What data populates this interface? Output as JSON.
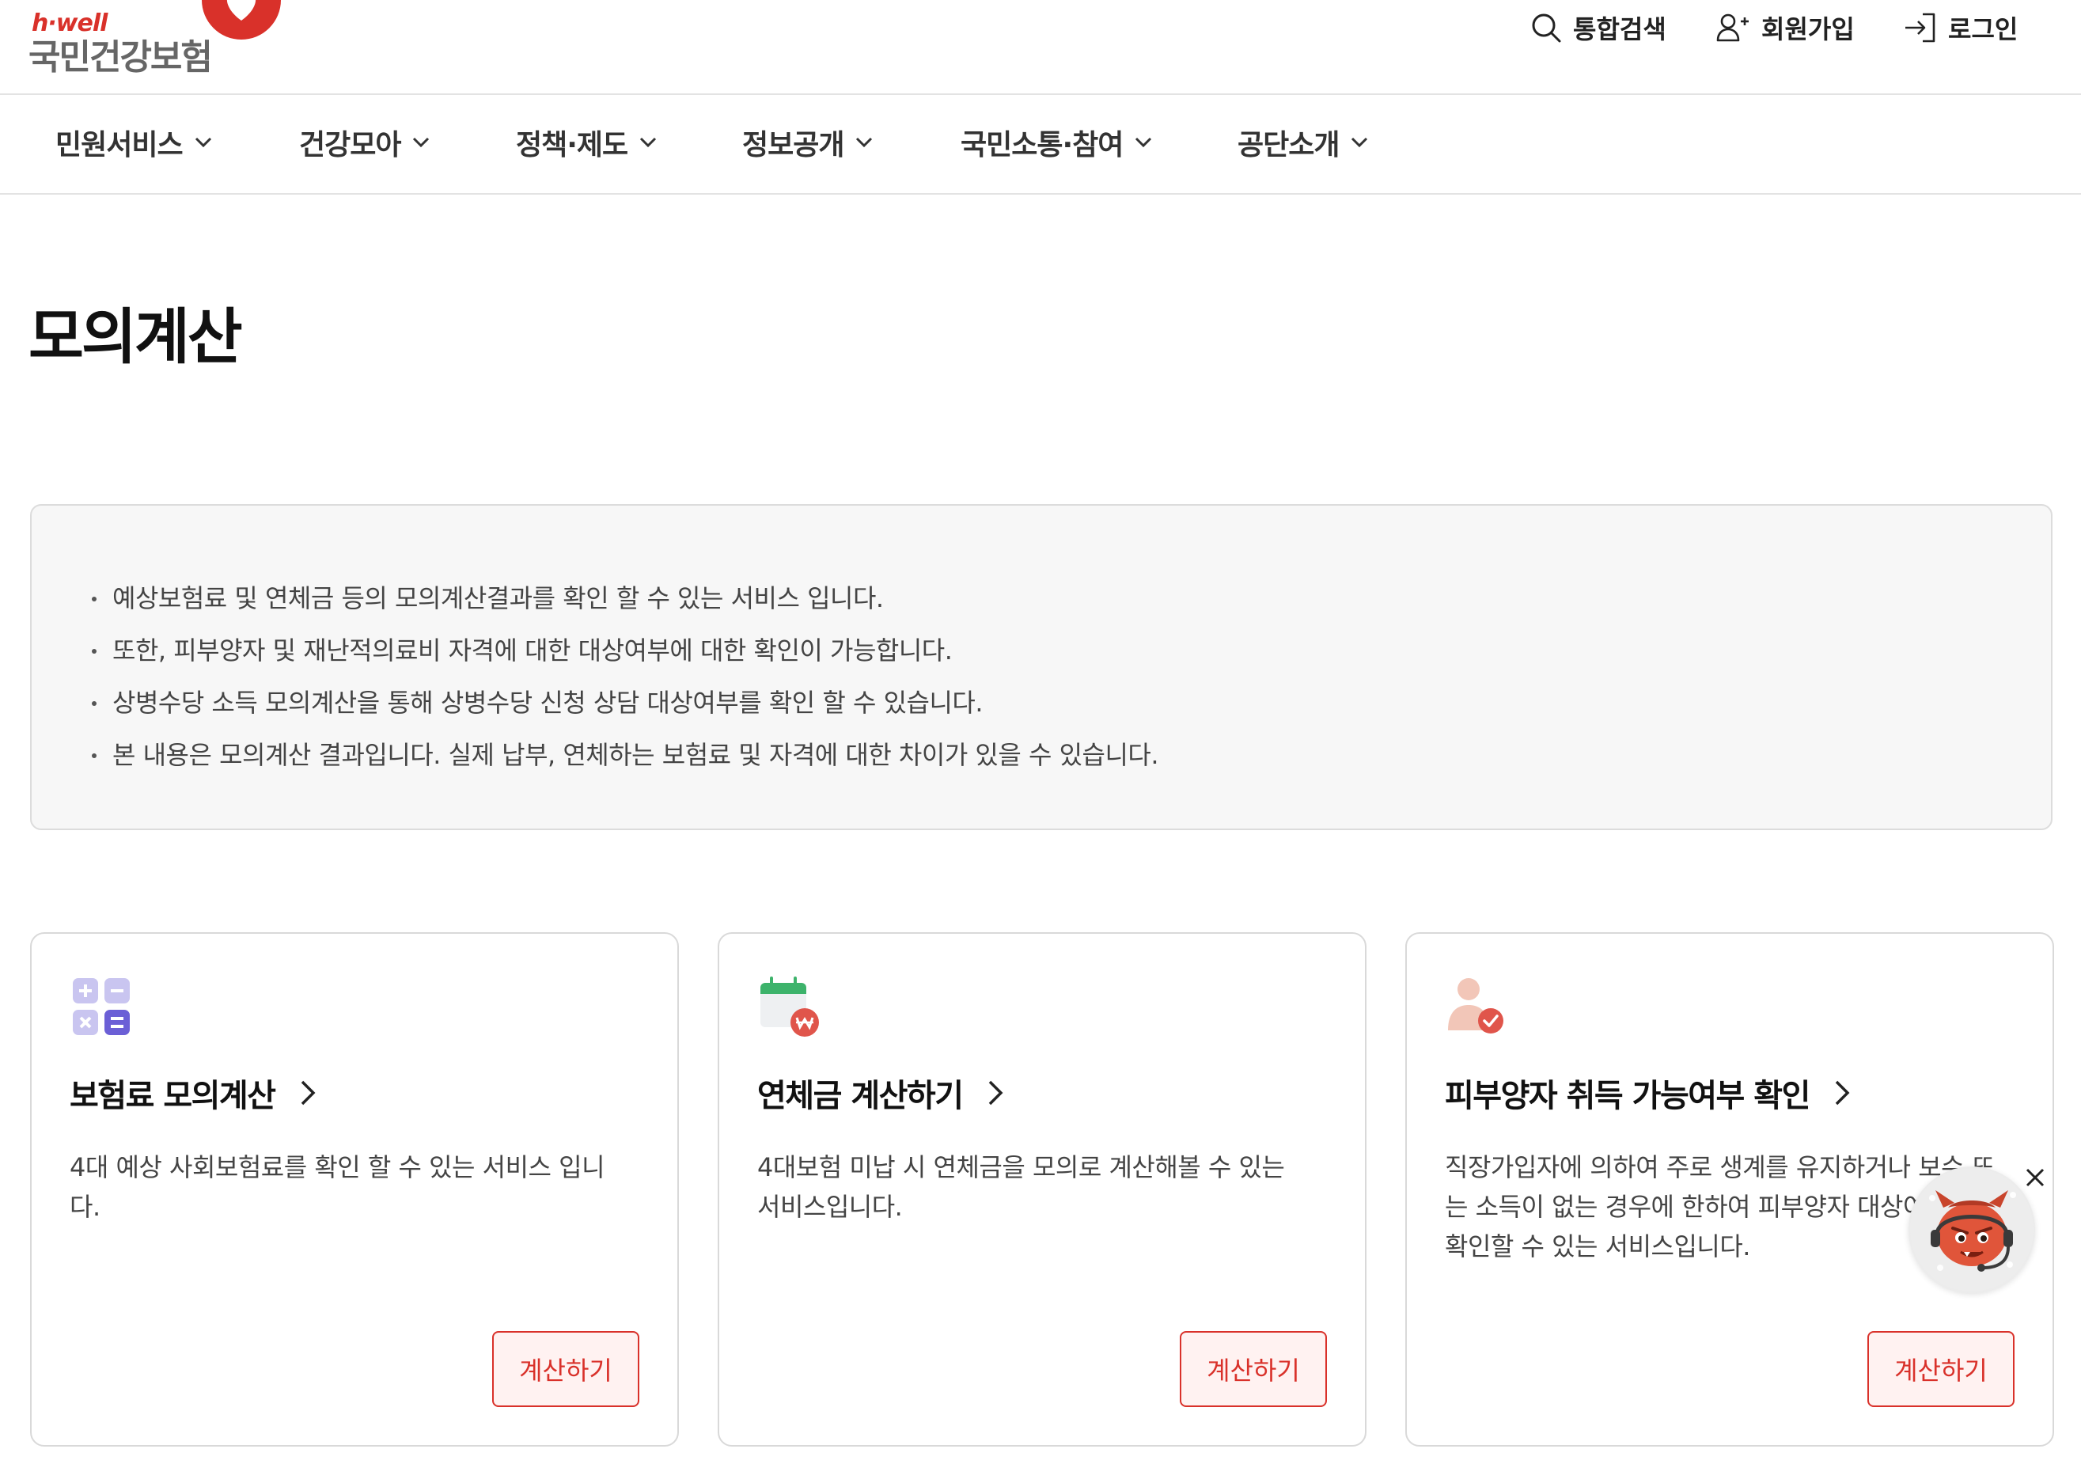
{
  "brand": {
    "tagline": "h·well",
    "name": "국민건강보험"
  },
  "util_nav": [
    {
      "label": "통합검색",
      "icon": "search-icon"
    },
    {
      "label": "회원가입",
      "icon": "user-add-icon"
    },
    {
      "label": "로그인",
      "icon": "login-icon"
    }
  ],
  "gnb": [
    {
      "label": "민원서비스"
    },
    {
      "label": "건강모아"
    },
    {
      "label": "정책·제도"
    },
    {
      "label": "정보공개"
    },
    {
      "label": "국민소통·참여"
    },
    {
      "label": "공단소개"
    }
  ],
  "page": {
    "title": "모의계산"
  },
  "info": [
    "예상보험료 및 연체금 등의 모의계산결과를 확인 할 수 있는 서비스 입니다.",
    "또한, 피부양자 및 재난적의료비 자격에 대한 대상여부에 대한 확인이 가능합니다.",
    "상병수당 소득 모의계산을 통해 상병수당 신청 상담 대상여부를 확인 할 수 있습니다.",
    "본 내용은 모의계산 결과입니다. 실제 납부, 연체하는 보험료 및 자격에 대한 차이가 있을 수 있습니다."
  ],
  "cards": [
    {
      "title": "보험료 모의계산",
      "icon": "calculator-icon",
      "desc": "4대 예상 사회보험료를 확인 할 수 있는 서비스 입니다.",
      "button": "계산하기"
    },
    {
      "title": "연체금 계산하기",
      "icon": "calendar-won-icon",
      "desc": "4대보험 미납 시 연체금을 모의로 계산해볼 수 있는 서비스입니다.",
      "button": "계산하기"
    },
    {
      "title": "피부양자 취득 가능여부 확인",
      "icon": "user-check-icon",
      "desc": "직장가입자에 의하여 주로 생계를 유지하거나 보수 또는 소득이 없는 경우에 한하여 피부양자 대상여부를 확인할 수 있는 서비스입니다.",
      "button": "계산하기"
    }
  ],
  "chatbot": {
    "icon": "chatbot-mascot-icon",
    "close_icon": "close-icon"
  },
  "colors": {
    "accent": "#d9312a",
    "text": "#222222",
    "border": "#dcdcdc",
    "info_bg": "#f7f7f7",
    "icon_purple": "#6b5fd6"
  }
}
